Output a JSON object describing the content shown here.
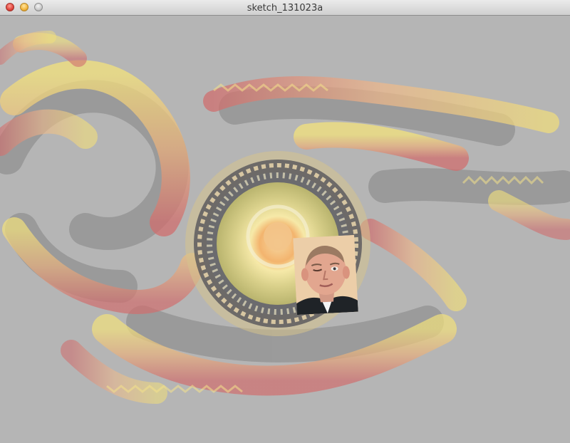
{
  "window": {
    "title": "sketch_131023a",
    "controls": [
      "close-button",
      "minimize-button",
      "zoom-button"
    ]
  },
  "canvas": {
    "background": "#b5b5b5",
    "palette": {
      "petal_yellow": "#f2e47a",
      "petal_peach": "#e9b37c",
      "petal_red": "#d46a6a",
      "dark_shadow": "#5a5a5a",
      "core_center": "#f4c07a"
    }
  },
  "photo": {
    "subject": "man-in-suit-winking"
  }
}
